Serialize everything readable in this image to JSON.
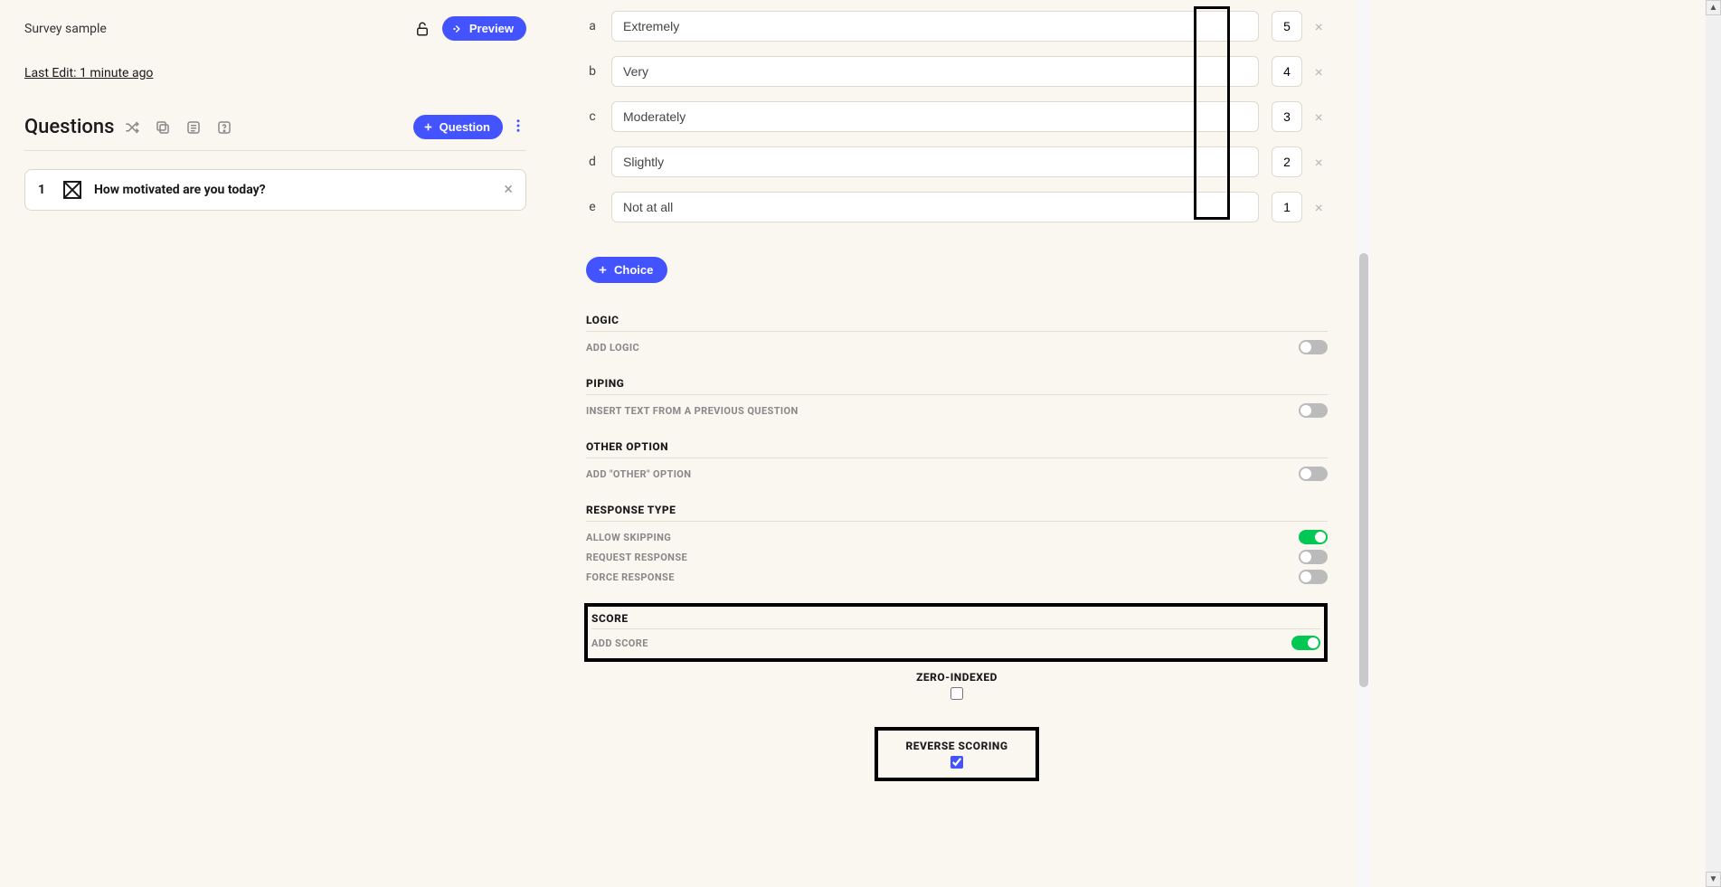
{
  "survey": {
    "title": "Survey sample",
    "preview_label": "Preview",
    "last_edit": "Last Edit: 1 minute ago"
  },
  "questions_panel": {
    "heading": "Questions",
    "add_question_label": "Question"
  },
  "question": {
    "number": "1",
    "text": "How motivated are you today?"
  },
  "choices": [
    {
      "letter": "a",
      "label": "Extremely",
      "score": "5"
    },
    {
      "letter": "b",
      "label": "Very",
      "score": "4"
    },
    {
      "letter": "c",
      "label": "Moderately",
      "score": "3"
    },
    {
      "letter": "d",
      "label": "Slightly",
      "score": "2"
    },
    {
      "letter": "e",
      "label": "Not at all",
      "score": "1"
    }
  ],
  "add_choice_label": "Choice",
  "sections": {
    "logic": {
      "title": "LOGIC",
      "sub": "ADD LOGIC",
      "on": false
    },
    "piping": {
      "title": "PIPING",
      "sub": "INSERT TEXT FROM A PREVIOUS QUESTION",
      "on": false
    },
    "other": {
      "title": "OTHER OPTION",
      "sub": "ADD \"OTHER\" OPTION",
      "on": false
    },
    "response_type": {
      "title": "RESPONSE TYPE",
      "allow_skipping": {
        "label": "ALLOW SKIPPING",
        "on": true
      },
      "request_response": {
        "label": "REQUEST RESPONSE",
        "on": false
      },
      "force_response": {
        "label": "FORCE RESPONSE",
        "on": false
      }
    },
    "score": {
      "title": "SCORE",
      "sub": "ADD SCORE",
      "on": true
    }
  },
  "score_options": {
    "zero_indexed": {
      "label": "ZERO-INDEXED",
      "checked": false
    },
    "reverse_scoring": {
      "label": "REVERSE SCORING",
      "checked": true
    }
  }
}
